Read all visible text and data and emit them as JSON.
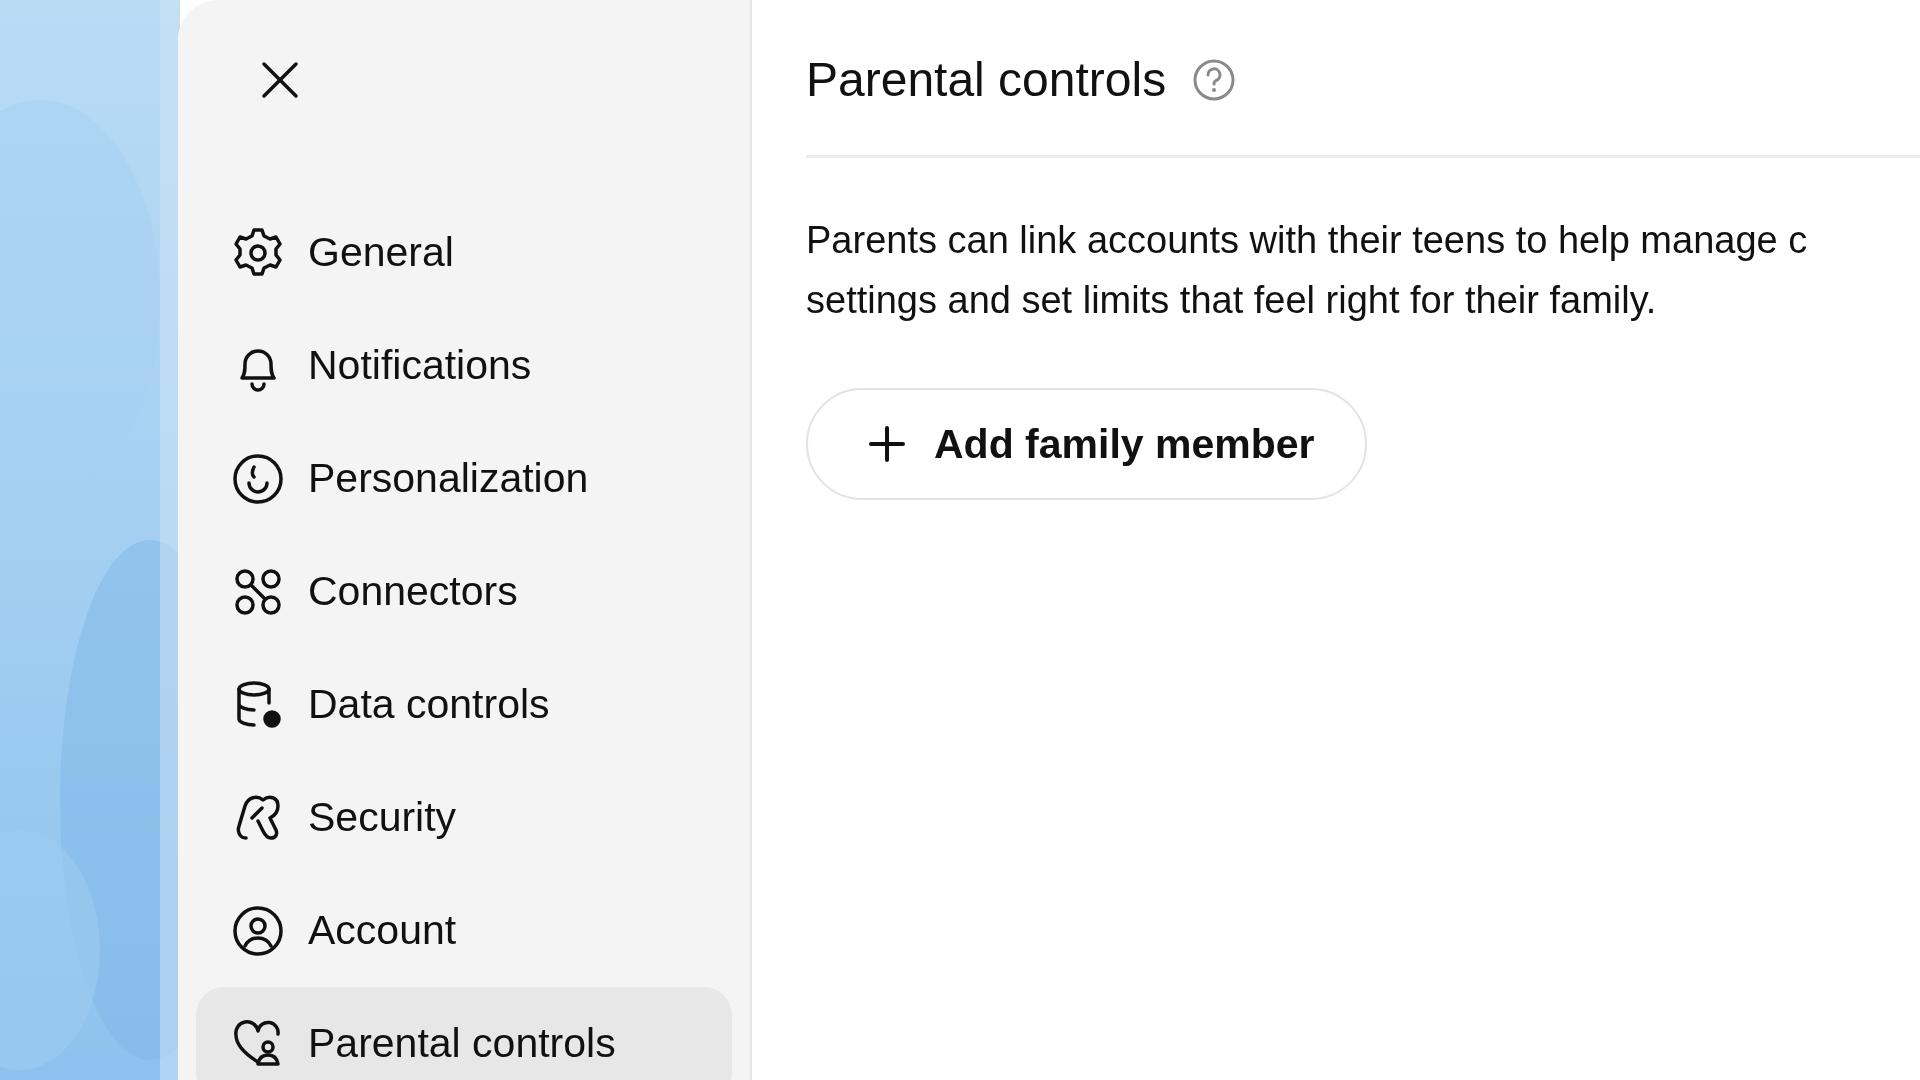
{
  "sidebar": {
    "items": [
      {
        "kind": "gear",
        "label": "General",
        "selected": false
      },
      {
        "kind": "bell",
        "label": "Notifications",
        "selected": false
      },
      {
        "kind": "face",
        "label": "Personalization",
        "selected": false
      },
      {
        "kind": "nodes",
        "label": "Connectors",
        "selected": false
      },
      {
        "kind": "database",
        "label": "Data controls",
        "selected": false
      },
      {
        "kind": "shield",
        "label": "Security",
        "selected": false
      },
      {
        "kind": "person",
        "label": "Account",
        "selected": false
      },
      {
        "kind": "heart",
        "label": "Parental controls",
        "selected": true
      }
    ]
  },
  "content": {
    "title": "Parental controls",
    "description_lines": [
      "Parents can link accounts with their teens to help manage c",
      "settings and set limits that feel right for their family."
    ],
    "add_button": "Add family member"
  }
}
